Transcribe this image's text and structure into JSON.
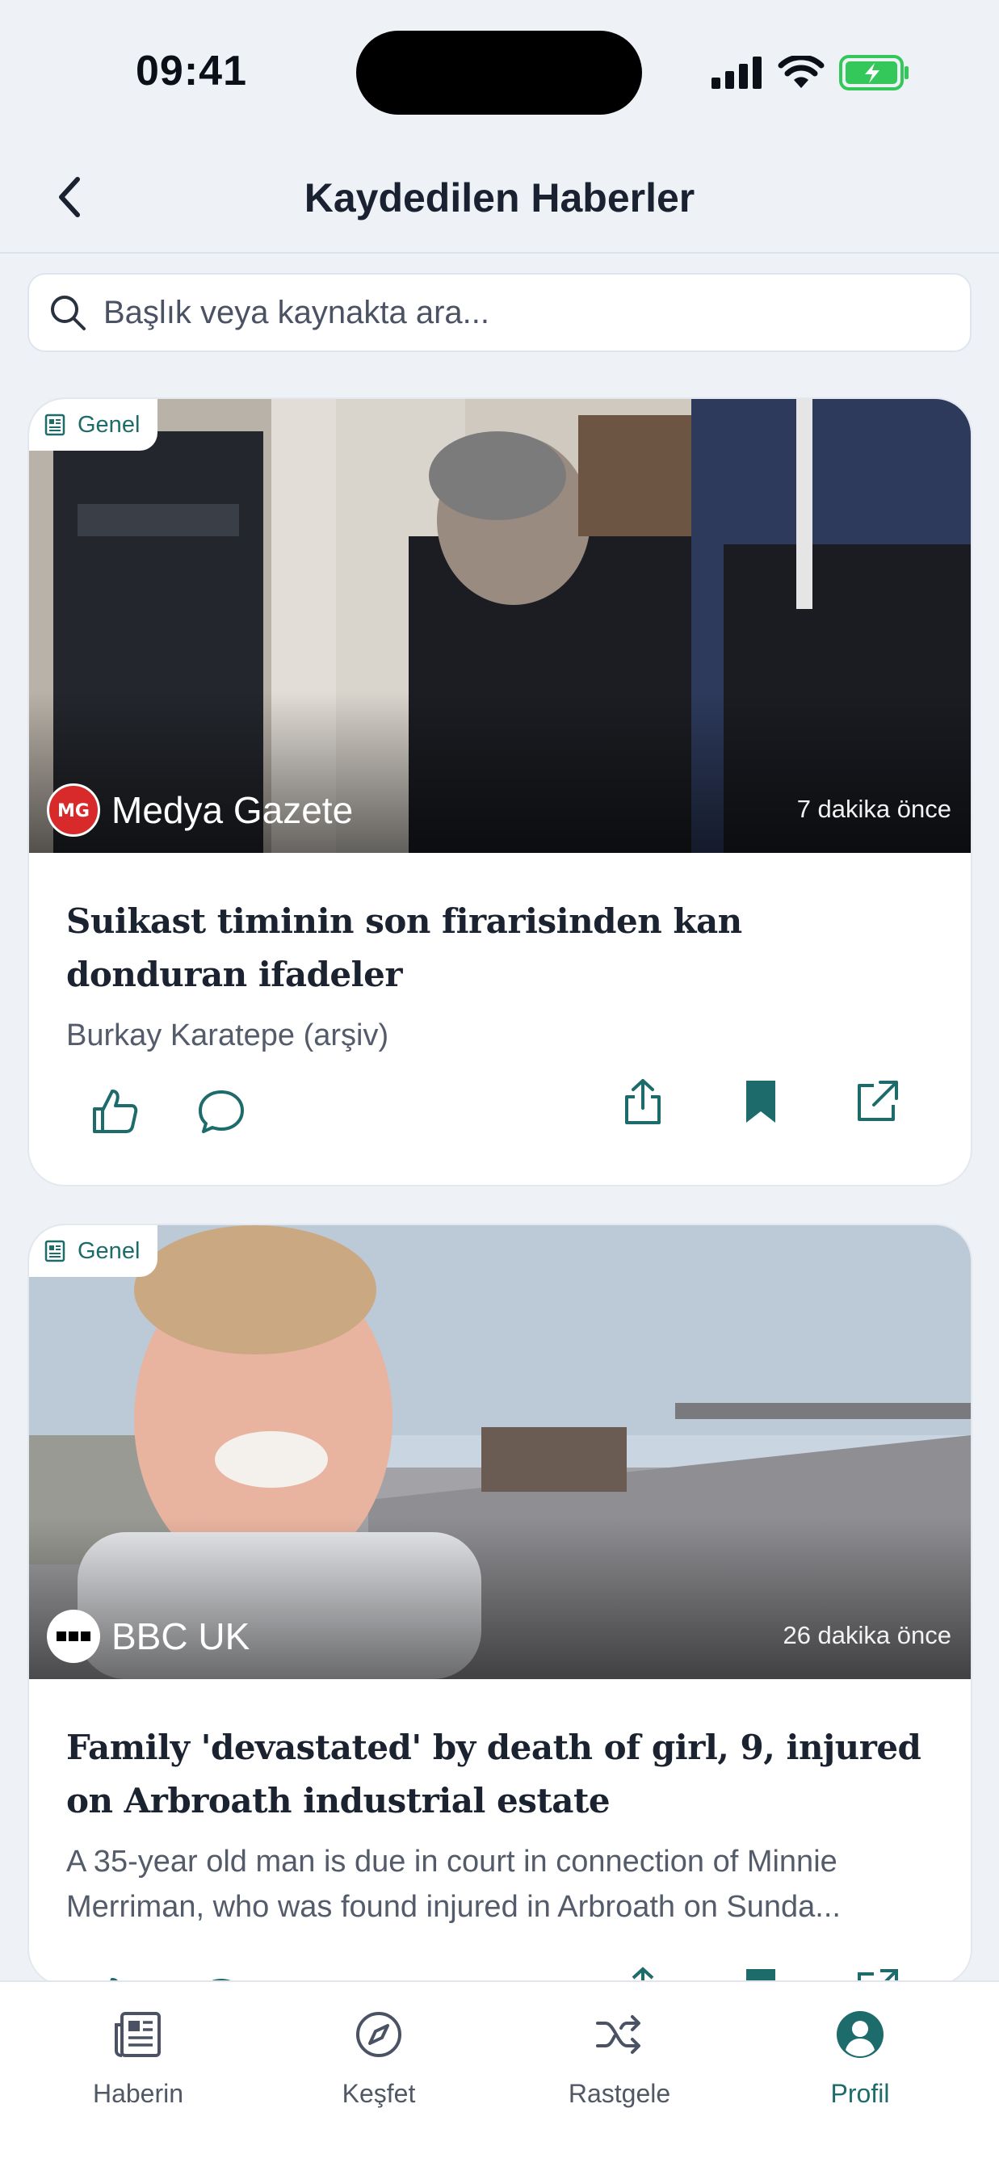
{
  "status_bar": {
    "time": "09:41"
  },
  "header": {
    "title": "Kaydedilen Haberler"
  },
  "search": {
    "placeholder": "Başlık veya kaynakta ara..."
  },
  "articles": [
    {
      "category": "Genel",
      "source": "Medya Gazete",
      "time_ago": "7 dakika önce",
      "headline": "Suikast timinin son firarisinden kan donduran ifadeler",
      "summary": "Burkay Karatepe (arşiv)"
    },
    {
      "category": "Genel",
      "source": "BBC UK",
      "time_ago": "26 dakika önce",
      "headline": "Family 'devastated' by death of girl, 9, injured on Arbroath industrial estate",
      "summary": "A 35-year old man is due in court in connection of Minnie Merriman, who was found injured in Arbroath on Sunda..."
    }
  ],
  "bottom_nav": [
    {
      "label": "Haberin",
      "icon": "newspaper-icon"
    },
    {
      "label": "Keşfet",
      "icon": "compass-icon"
    },
    {
      "label": "Rastgele",
      "icon": "shuffle-icon"
    },
    {
      "label": "Profil",
      "icon": "profile-icon",
      "active": true
    }
  ],
  "colors": {
    "accent": "#1d6b6b",
    "background": "#eef2f7",
    "battery": "#34c759"
  }
}
